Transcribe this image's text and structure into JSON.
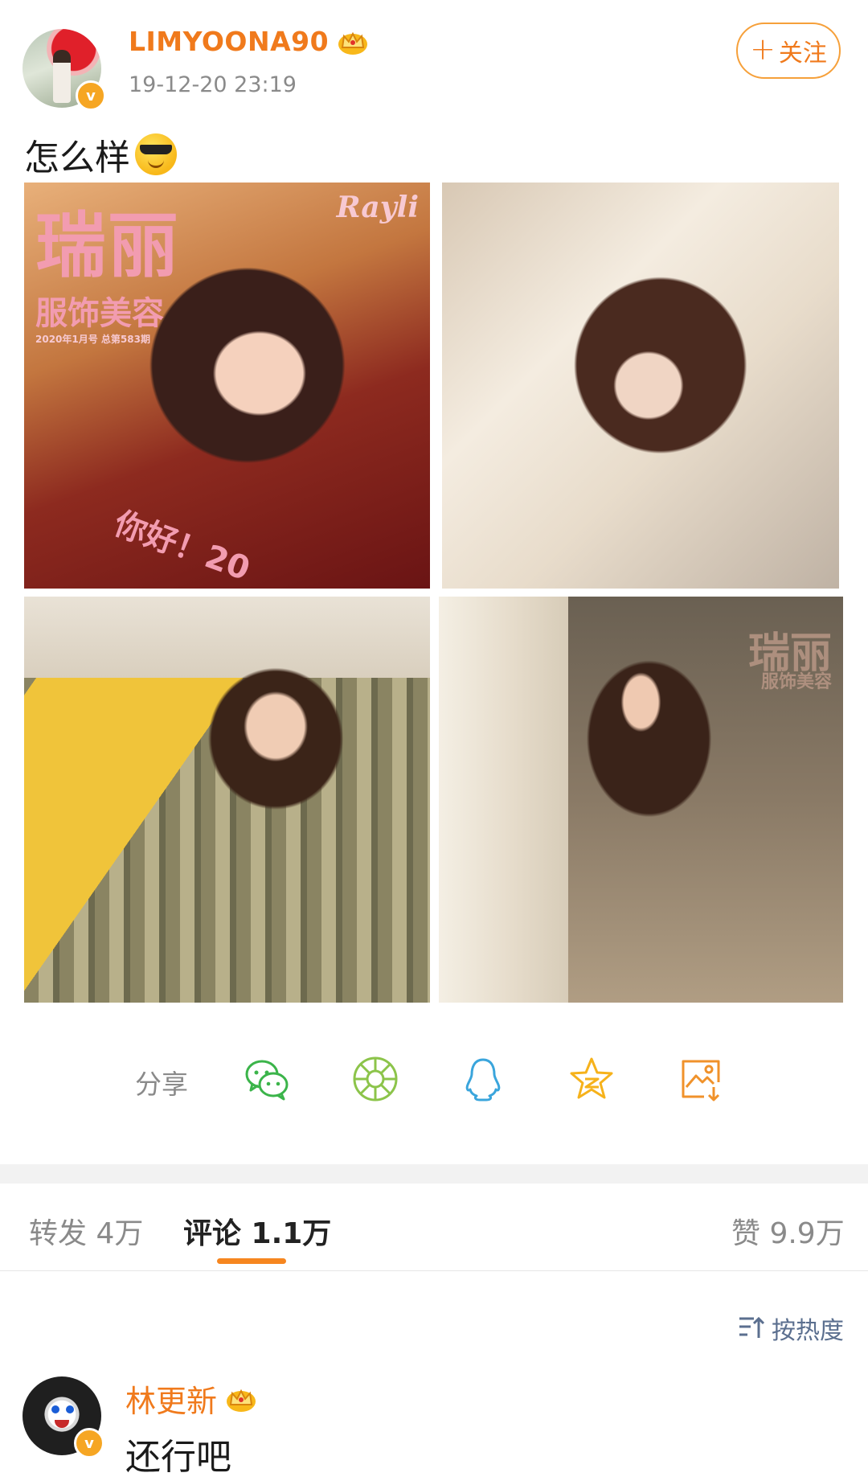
{
  "post": {
    "username": "LIMYOONA90",
    "timestamp": "19-12-20 23:19",
    "follow_label": "关注",
    "text": "怎么样",
    "photos": [
      {
        "overlay": {
          "title": "瑞丽",
          "subtitle": "服饰美容",
          "issue": "2020年1月号 总第583期",
          "logo": "Rayli",
          "greeting": "你好！20"
        }
      },
      {},
      {},
      {
        "overlay": {
          "title": "瑞丽",
          "subtitle": "服饰美容"
        }
      }
    ]
  },
  "share": {
    "label": "分享",
    "icons": [
      "wechat-icon",
      "moments-icon",
      "qq-icon",
      "qzone-icon",
      "save-image-icon"
    ]
  },
  "tabs": {
    "repost": "转发 4万",
    "comments": "评论 1.1万",
    "likes": "赞 9.9万"
  },
  "sort": {
    "label": "按热度"
  },
  "comments": [
    {
      "author": "林更新",
      "text": "还行吧"
    }
  ],
  "colors": {
    "accent": "#f07a1c",
    "tab_underline": "#f6861f",
    "link_blue": "#5b6f8f",
    "verified": "#f6a623"
  }
}
